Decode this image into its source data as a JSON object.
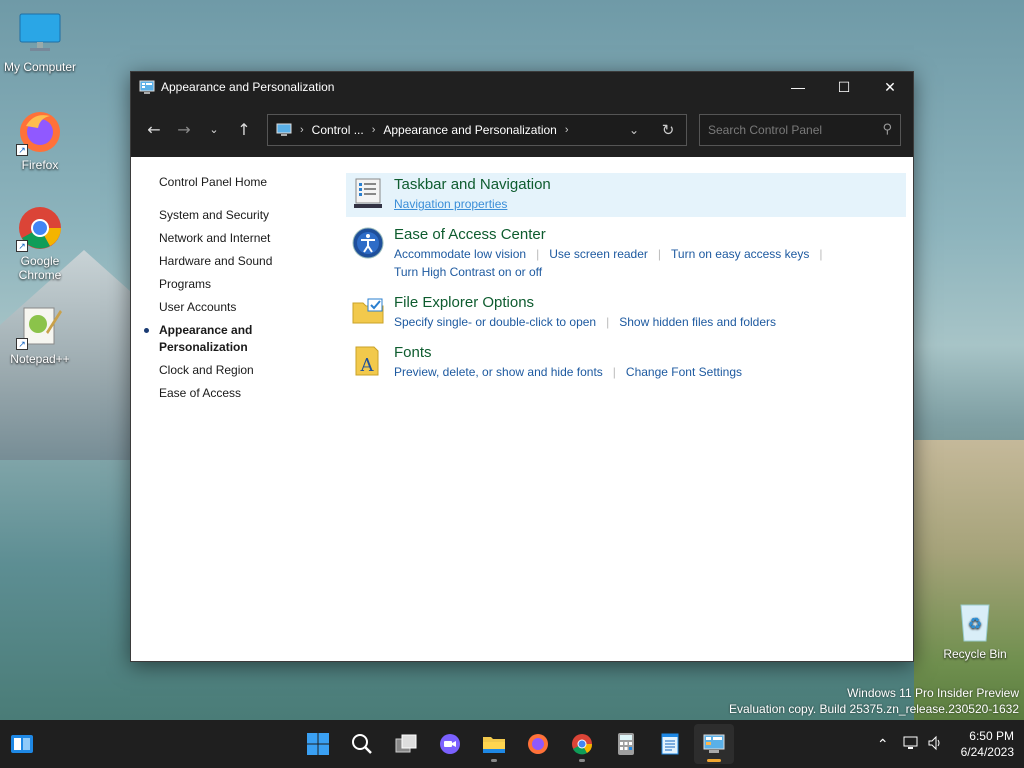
{
  "colors": {
    "accent": "#1e5aa0",
    "category_title": "#0e5c2f",
    "titlebar": "#202020",
    "taskbar": "#1f1f1f"
  },
  "desktop": {
    "icons": [
      {
        "label": "My Computer",
        "icon": "monitor-icon"
      },
      {
        "label": "Firefox",
        "icon": "firefox-icon"
      },
      {
        "label": "Google Chrome",
        "icon": "chrome-icon"
      },
      {
        "label": "Notepad++",
        "icon": "notepadpp-icon"
      },
      {
        "label": "Recycle Bin",
        "icon": "recycle-bin-icon"
      }
    ],
    "watermark_line1": "Windows 11 Pro Insider Preview",
    "watermark_line2": "Evaluation copy. Build 25375.zn_release.230520-1632"
  },
  "window": {
    "title": "Appearance and Personalization",
    "breadcrumb": [
      "Control ...",
      "Appearance and Personalization"
    ],
    "search_placeholder": "Search Control Panel"
  },
  "sidebar": {
    "home": "Control Panel Home",
    "items": [
      "System and Security",
      "Network and Internet",
      "Hardware and Sound",
      "Programs",
      "User Accounts",
      "Appearance and Personalization",
      "Clock and Region",
      "Ease of Access"
    ]
  },
  "categories": [
    {
      "title": "Taskbar and Navigation",
      "links": [
        "Navigation properties"
      ]
    },
    {
      "title": "Ease of Access Center",
      "links": [
        "Accommodate low vision",
        "Use screen reader",
        "Turn on easy access keys",
        "Turn High Contrast on or off"
      ]
    },
    {
      "title": "File Explorer Options",
      "links": [
        "Specify single- or double-click to open",
        "Show hidden files and folders"
      ]
    },
    {
      "title": "Fonts",
      "links": [
        "Preview, delete, or show and hide fonts",
        "Change Font Settings"
      ]
    }
  ],
  "taskbar": {
    "time": "6:50 PM",
    "date": "6/24/2023"
  }
}
